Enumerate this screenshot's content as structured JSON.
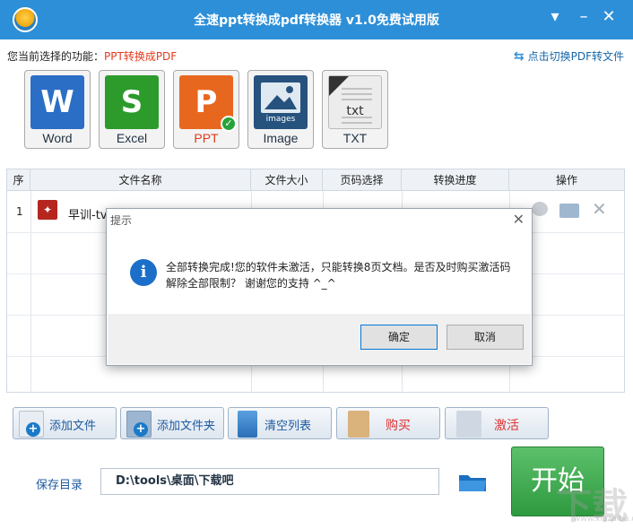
{
  "window": {
    "title": "全速ppt转换成pdf转换器 v1.0免费试用版"
  },
  "function_bar": {
    "label": "您当前选择的功能：",
    "value": "PPT转换成PDF",
    "switch_label": "点击切换PDF转文件"
  },
  "formats": [
    {
      "label": "Word",
      "glyph": "W",
      "color": "#2b6ec5",
      "selected": false
    },
    {
      "label": "Excel",
      "glyph": "S",
      "color": "#2c9b2c",
      "selected": false
    },
    {
      "label": "PPT",
      "glyph": "P",
      "color": "#e8671f",
      "selected": true
    },
    {
      "label": "Image",
      "glyph": "images",
      "color": "#26527e",
      "selected": false
    },
    {
      "label": "TXT",
      "glyph": "txt",
      "color": "#e9e9e9",
      "selected": false
    }
  ],
  "table": {
    "headers": {
      "index": "序",
      "name": "文件名称",
      "size": "文件大小",
      "pages": "页码选择",
      "progress": "转换进度",
      "ops": "操作"
    },
    "rows": [
      {
        "index": "1",
        "name": "早训-tv..."
      }
    ]
  },
  "dialog": {
    "title": "提示",
    "message": "全部转换完成!您的软件未激活，只能转换8页文档。是否及时购买激活码解除全部限制？ 谢谢您的支持 ^_^",
    "ok_label": "确定",
    "cancel_label": "取消"
  },
  "actions": {
    "add_file": "添加文件",
    "add_folder": "添加文件夹",
    "clear_list": "清空列表",
    "buy": "购买",
    "activate": "激活"
  },
  "save": {
    "label": "保存目录",
    "path": "D:\\tools\\桌面\\下载吧"
  },
  "start_label": "开始"
}
